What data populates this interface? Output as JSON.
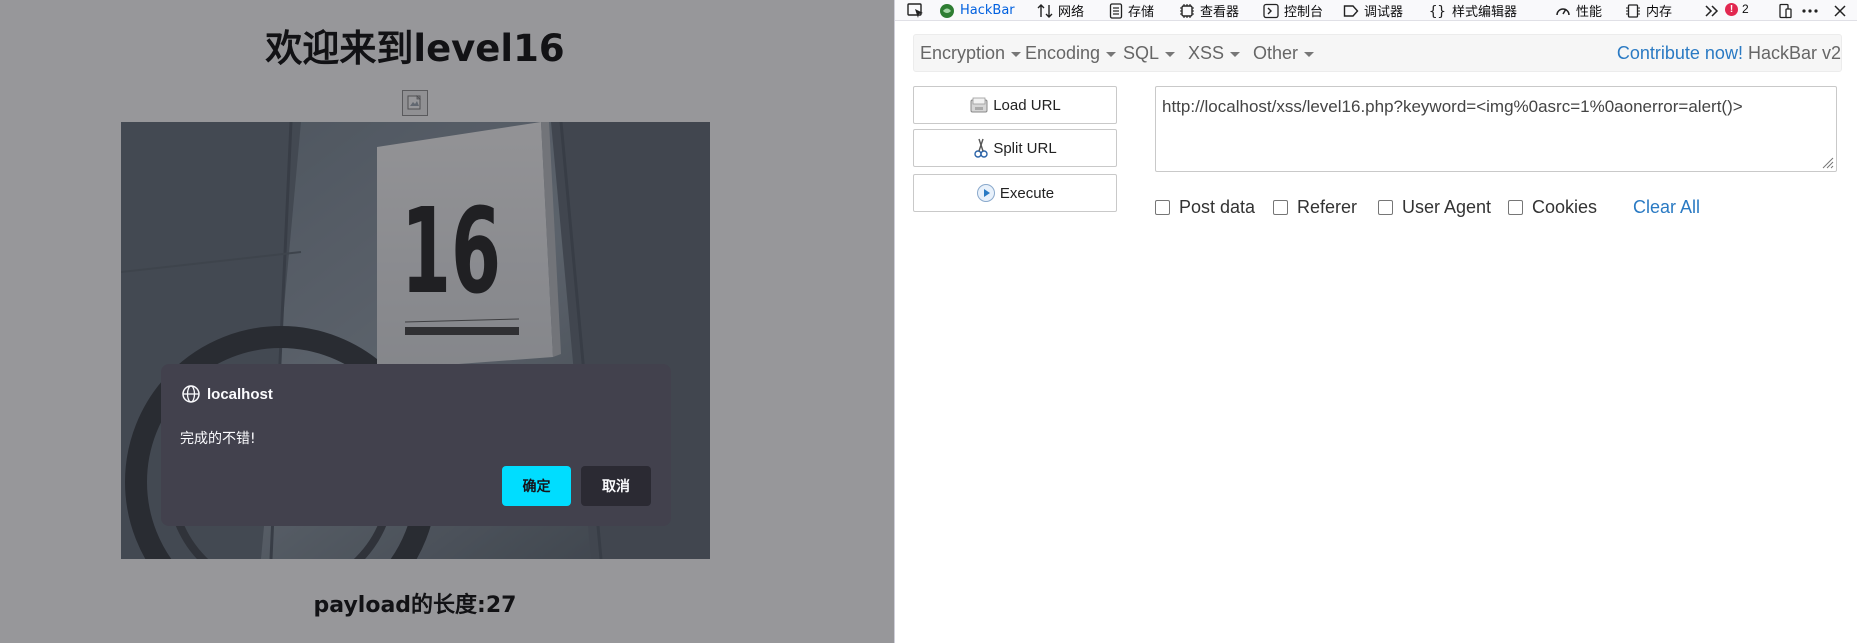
{
  "page": {
    "heading": "欢迎来到level16",
    "payload_length": "payload的长度:27"
  },
  "dialog": {
    "origin": "localhost",
    "message": "完成的不错!",
    "ok_label": "确定",
    "cancel_label": "取消"
  },
  "devtools": {
    "tabs": [
      {
        "label": "HackBar",
        "icon": "hackbar-icon",
        "active": true
      },
      {
        "label": "网络",
        "icon": "network-icon"
      },
      {
        "label": "存储",
        "icon": "storage-icon"
      },
      {
        "label": "查看器",
        "icon": "inspector-icon"
      },
      {
        "label": "控制台",
        "icon": "console-icon"
      },
      {
        "label": "调试器",
        "icon": "debugger-icon"
      },
      {
        "label": "样式编辑器",
        "icon": "style-editor-icon"
      },
      {
        "label": "性能",
        "icon": "performance-icon"
      },
      {
        "label": "内存",
        "icon": "memory-icon"
      }
    ],
    "error_count": "2"
  },
  "hackbar": {
    "menu": [
      "Encryption",
      "Encoding",
      "SQL",
      "XSS",
      "Other"
    ],
    "contribute_label": "Contribute now!",
    "version_label": "HackBar v2",
    "buttons": {
      "load_url": "Load URL",
      "split_url": "Split URL",
      "execute": "Execute"
    },
    "url_value": "http://localhost/xss/level16.php?keyword=<img%0asrc=1%0aonerror=alert()>",
    "options": [
      "Post data",
      "Referer",
      "User Agent",
      "Cookies"
    ],
    "clear_all_label": "Clear All"
  },
  "colors": {
    "accent_link": "#2a7ac3",
    "dialog_bg": "#42414d",
    "dialog_ok": "#00ddff",
    "error_badge": "#e22850"
  }
}
